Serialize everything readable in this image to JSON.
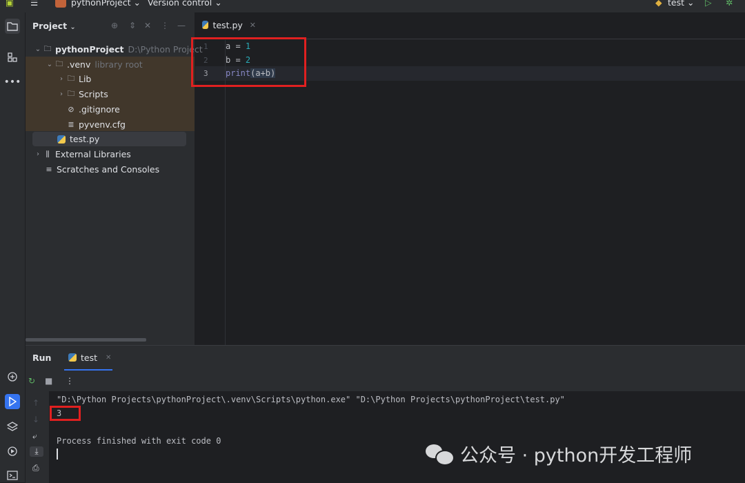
{
  "topbar": {
    "project_menu": "pythonProject",
    "vcs_menu": "Version control",
    "run_config": "test"
  },
  "project_panel": {
    "title": "Project",
    "tree": [
      {
        "label": "pythonProject",
        "hint": "D:\\Python Project",
        "icon": "folder-icon"
      },
      {
        "label": ".venv",
        "hint": "library root",
        "icon": "folder-icon"
      },
      {
        "label": "Lib",
        "icon": "folder-icon"
      },
      {
        "label": "Scripts",
        "icon": "folder-icon"
      },
      {
        "label": ".gitignore",
        "icon": "ignore-file-icon"
      },
      {
        "label": "pyvenv.cfg",
        "icon": "config-file-icon"
      },
      {
        "label": "test.py",
        "icon": "python-file-icon"
      },
      {
        "label": "External Libraries",
        "icon": "libraries-icon"
      },
      {
        "label": "Scratches and Consoles",
        "icon": "scratches-icon"
      }
    ]
  },
  "editor": {
    "tab_label": "test.py",
    "lines": [
      {
        "num": "1",
        "a": "a = ",
        "b": "1"
      },
      {
        "num": "2",
        "a": "b = ",
        "b": "2"
      },
      {
        "num": "3",
        "fn": "print",
        "rest": "(a+b)"
      }
    ]
  },
  "run": {
    "title": "Run",
    "tab_label": "test",
    "command": "\"D:\\Python Projects\\pythonProject\\.venv\\Scripts\\python.exe\" \"D:\\Python Projects\\pythonProject\\test.py\"",
    "result": "3",
    "finished": "Process finished with exit code 0"
  },
  "watermark": {
    "text": "公众号 · python开发工程师"
  }
}
